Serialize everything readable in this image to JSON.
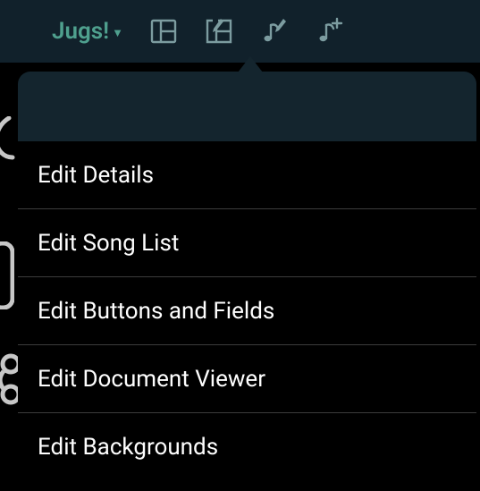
{
  "colors": {
    "accent": "#4fa08e",
    "iconMuted": "#7c9ca0",
    "panelHeader": "#14252e",
    "topBar": "#11212b",
    "divider": "#3c3c3c"
  },
  "header": {
    "title_label": "Jugs!",
    "icons": {
      "layout": "layout-icon",
      "layoutEdit": "layout-edit-icon",
      "noteEdit": "music-note-edit-icon",
      "noteAdd": "music-note-add-icon"
    }
  },
  "menu": {
    "items": [
      {
        "label": "Edit Details"
      },
      {
        "label": "Edit Song List"
      },
      {
        "label": "Edit Buttons and Fields"
      },
      {
        "label": "Edit Document Viewer"
      },
      {
        "label": "Edit Backgrounds"
      }
    ]
  }
}
